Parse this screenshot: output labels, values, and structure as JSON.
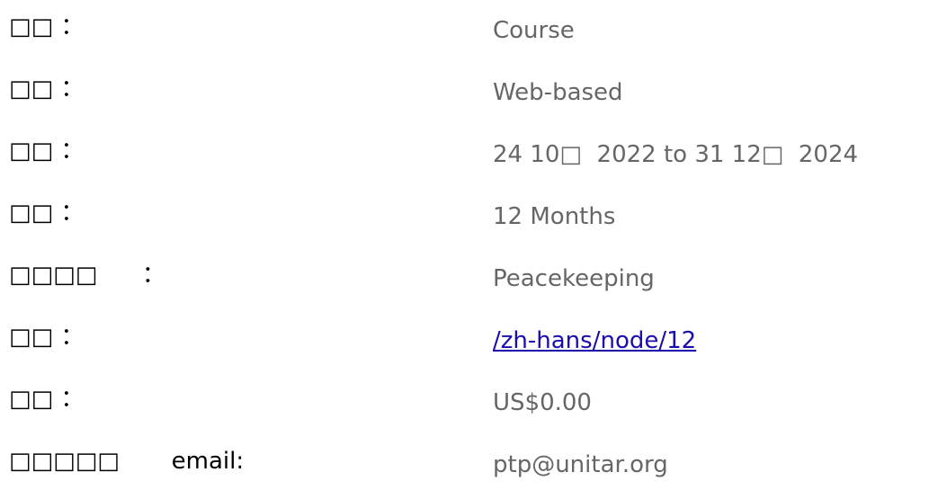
{
  "details": {
    "rows": [
      {
        "label": "□□ ：",
        "value": "Course"
      },
      {
        "label": "□□ ：",
        "value": "Web-based"
      },
      {
        "label": "□□ ：",
        "value": "24 10□  2022 to 31 12□  2024"
      },
      {
        "label": "□□ ：",
        "value": "12 Months"
      },
      {
        "label": "□□□□      ：",
        "value": "Peacekeeping"
      },
      {
        "label": "□□ ：",
        "value": "/zh-hans/node/12"
      },
      {
        "label": "□□ ：",
        "value": "US$0.00"
      },
      {
        "label": "□□□□□       email:",
        "value": "ptp@unitar.org"
      }
    ]
  }
}
